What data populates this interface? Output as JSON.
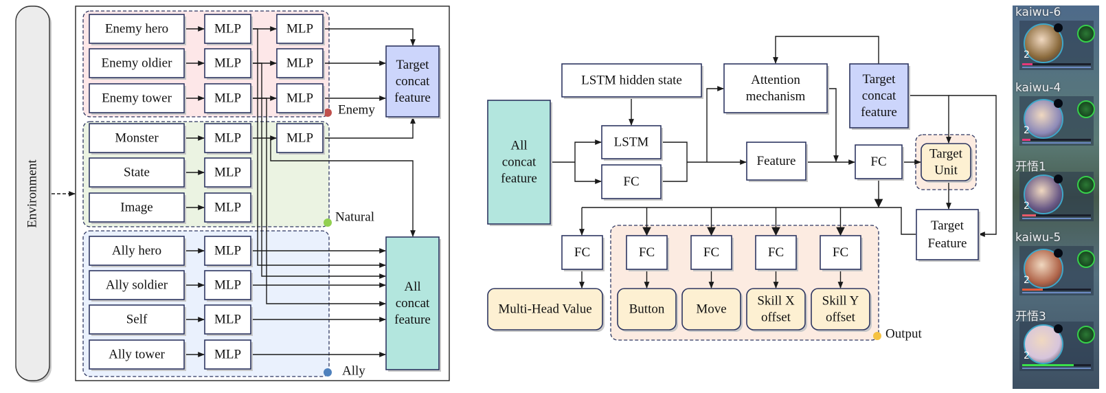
{
  "left_diagram": {
    "environment_label": "Environment",
    "groups": [
      {
        "name": "Enemy",
        "color": "#fde7e8",
        "dot_color": "#c0504d",
        "rows": [
          {
            "input": "Enemy hero",
            "mlp1": "MLP",
            "mlp2": "MLP"
          },
          {
            "input": "Enemy oldier",
            "mlp1": "MLP",
            "mlp2": "MLP"
          },
          {
            "input": "Enemy tower",
            "mlp1": "MLP",
            "mlp2": "MLP"
          }
        ]
      },
      {
        "name": "Natural",
        "color": "#ebf3e2",
        "dot_color": "#92d050",
        "rows": [
          {
            "input": "Monster",
            "mlp1": "MLP",
            "mlp2": "MLP"
          },
          {
            "input": "State",
            "mlp1": "MLP"
          },
          {
            "input": "Image",
            "mlp1": "MLP"
          }
        ]
      },
      {
        "name": "Ally",
        "color": "#eaf1fd",
        "dot_color": "#4f81bd",
        "rows": [
          {
            "input": "Ally hero",
            "mlp1": "MLP"
          },
          {
            "input": "Ally soldier",
            "mlp1": "MLP"
          },
          {
            "input": "Self",
            "mlp1": "MLP"
          },
          {
            "input": "Ally tower",
            "mlp1": "MLP"
          }
        ]
      }
    ],
    "target_concat": "Target concat feature",
    "all_concat": "All concat feature",
    "colors": {
      "target_concat": "#ccd5fb",
      "all_concat": "#b3e6de"
    }
  },
  "right_diagram": {
    "all_concat": "All concat feature",
    "lstm_hidden": "LSTM hidden state",
    "lstm": "LSTM",
    "fc_side": "FC",
    "attention": "Attention mechanism",
    "target_concat": "Target concat feature",
    "feature": "Feature",
    "fc_main": "FC",
    "target_unit": "Target Unit",
    "target_feature": "Target Feature",
    "value_fc": "FC",
    "value_head": "Multi-Head Value",
    "output_group_label": "Output",
    "output_heads": [
      {
        "fc": "FC",
        "label": "Button"
      },
      {
        "fc": "FC",
        "label": "Move"
      },
      {
        "fc": "FC",
        "label": "Skill X offset"
      },
      {
        "fc": "FC",
        "label": "Skill Y offset"
      }
    ],
    "colors": {
      "head": "#fdf0d2",
      "output_group": "#fcebe1",
      "output_dot": "#f5c242"
    }
  },
  "game_panel": {
    "heroes": [
      {
        "name": "kaiwu-6",
        "level": "2",
        "hp": 0.15,
        "hp_color": "#e8387a",
        "portrait": "#8a6a3c"
      },
      {
        "name": "kaiwu-4",
        "level": "2",
        "hp": 0.12,
        "hp_color": "#e8387a",
        "portrait": "#8d8ab8"
      },
      {
        "name": "开悟1",
        "level": "2",
        "hp": 0.2,
        "hp_color": "#e85a6a",
        "portrait": "#6a5a86"
      },
      {
        "name": "kaiwu-5",
        "level": "2",
        "hp": 0.3,
        "hp_color": "#e65a3a",
        "portrait": "#b0654a"
      },
      {
        "name": "开悟3",
        "level": "2",
        "hp": 0.75,
        "hp_color": "#3ae04a",
        "portrait": "#d6c4dc"
      }
    ]
  }
}
